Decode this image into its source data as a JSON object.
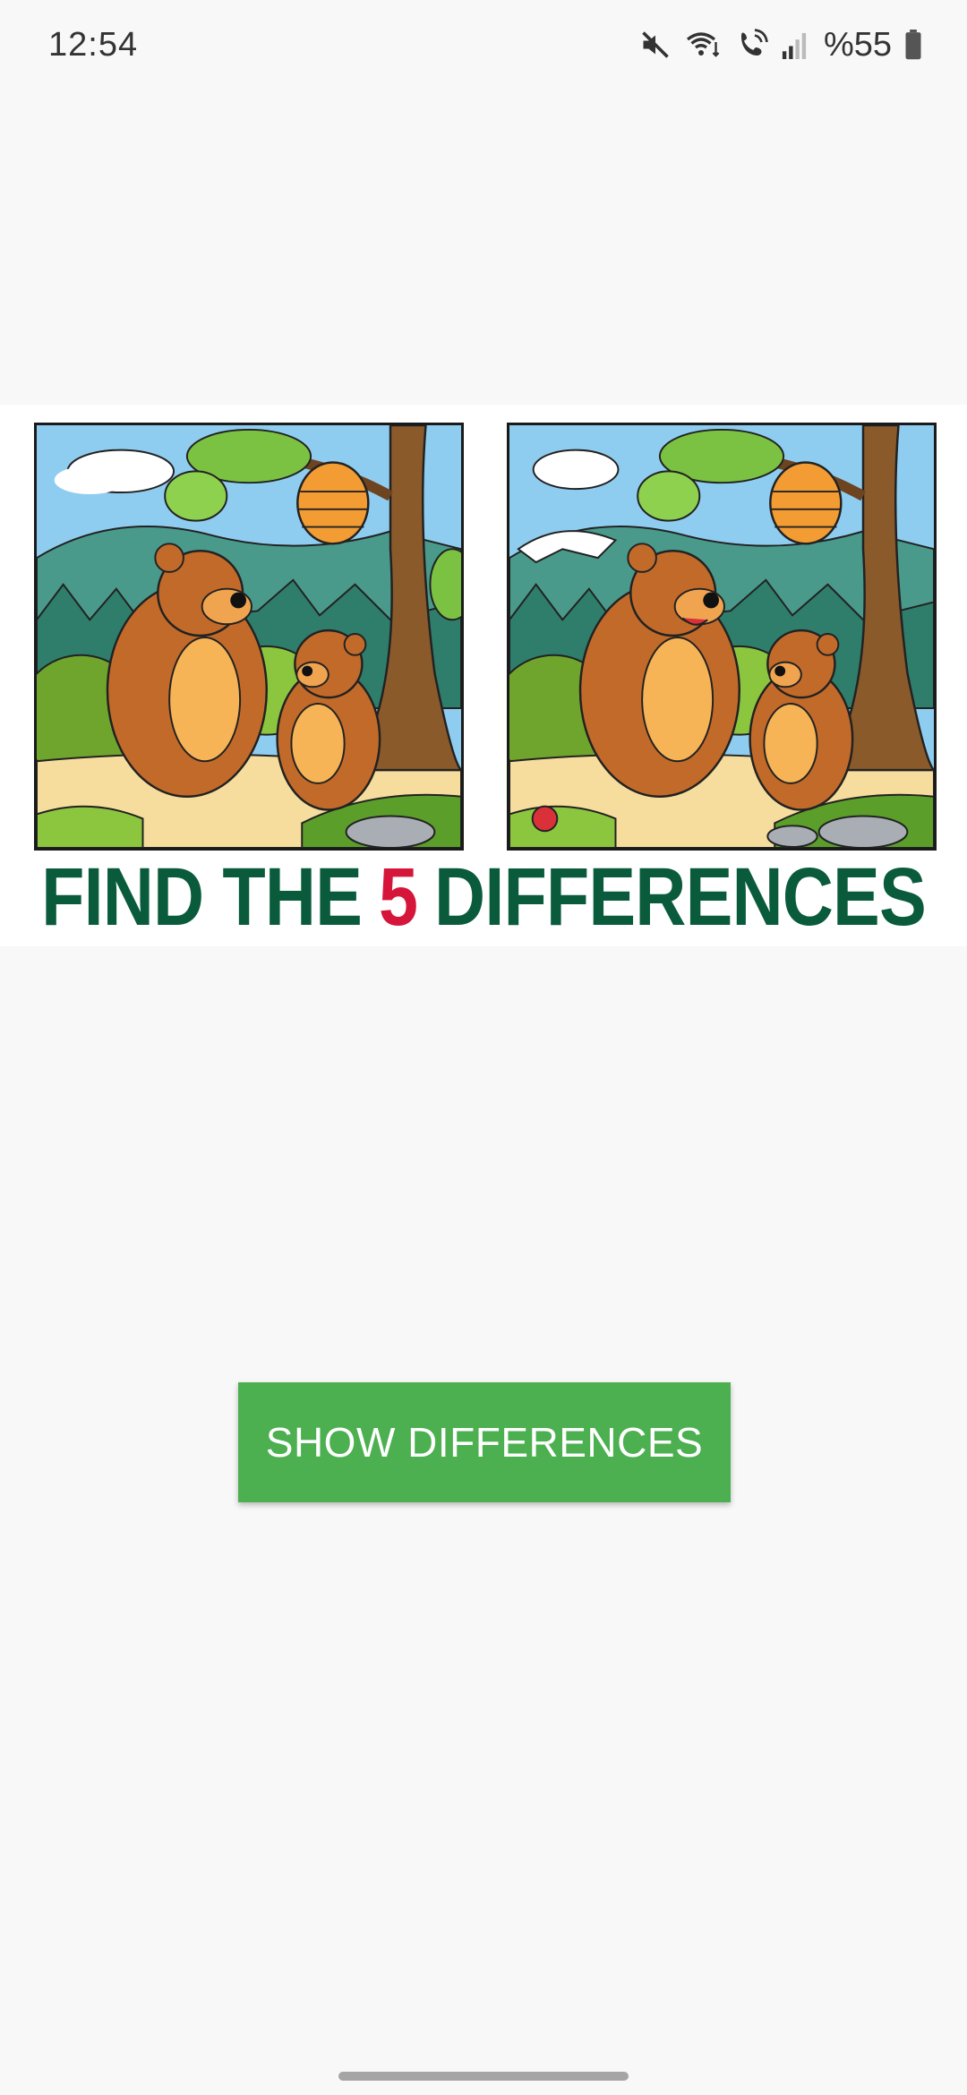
{
  "status_bar": {
    "time": "12:54",
    "battery": "%55",
    "icons": [
      "mute-icon",
      "wifi-calling-icon",
      "volte-call-icon",
      "signal-icon",
      "battery-icon"
    ]
  },
  "puzzle": {
    "headline_before": "FIND THE",
    "headline_number": "5",
    "headline_after": "DIFFERENCES",
    "colors": {
      "headline": "#0a5b3c",
      "number": "#d6153a"
    },
    "images": [
      "left-scene",
      "right-scene"
    ]
  },
  "actions": {
    "show_differences": "SHOW DIFFERENCES",
    "button_color": "#4caf50"
  }
}
